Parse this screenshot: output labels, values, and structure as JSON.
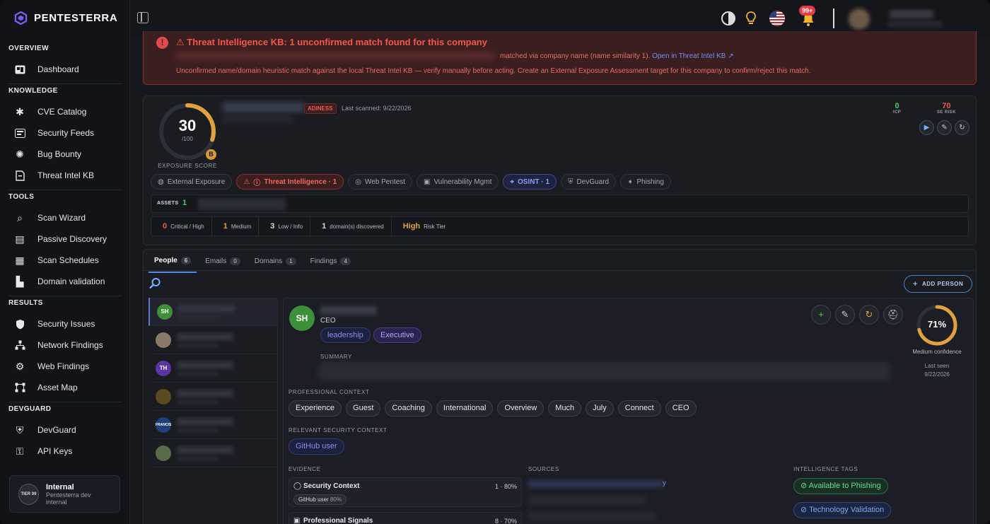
{
  "brand": {
    "name": "PENTESTERRA"
  },
  "sidebar": {
    "sections": [
      {
        "title": "OVERVIEW",
        "items": [
          {
            "label": "Dashboard",
            "icon": "dashboard-icon"
          }
        ]
      },
      {
        "title": "KNOWLEDGE",
        "items": [
          {
            "label": "CVE Catalog",
            "icon": "bug-catalog-icon"
          },
          {
            "label": "Security Feeds",
            "icon": "feed-icon"
          },
          {
            "label": "Bug Bounty",
            "icon": "bug-icon"
          },
          {
            "label": "Threat Intel KB",
            "icon": "document-icon"
          }
        ]
      },
      {
        "title": "TOOLS",
        "items": [
          {
            "label": "Scan Wizard",
            "icon": "wizard-icon"
          },
          {
            "label": "Passive Discovery",
            "icon": "discovery-icon"
          },
          {
            "label": "Scan Schedules",
            "icon": "calendar-icon"
          },
          {
            "label": "Domain validation",
            "icon": "building-icon"
          }
        ]
      },
      {
        "title": "RESULTS",
        "items": [
          {
            "label": "Security Issues",
            "icon": "shield-icon"
          },
          {
            "label": "Network Findings",
            "icon": "network-icon"
          },
          {
            "label": "Web Findings",
            "icon": "globe-icon"
          },
          {
            "label": "Asset Map",
            "icon": "map-icon"
          }
        ]
      },
      {
        "title": "DEVGUARD",
        "items": [
          {
            "label": "DevGuard",
            "icon": "devguard-icon"
          },
          {
            "label": "API Keys",
            "icon": "key-icon"
          }
        ]
      }
    ],
    "org": {
      "badge": "TIER 99",
      "name": "Internal",
      "subtitle": "Pentesterra dev internal"
    }
  },
  "topbar": {
    "notifications": "99+"
  },
  "alert": {
    "title": "⚠ Threat Intelligence KB: 1 unconfirmed match found for this company",
    "line1": "matched via company name (name similarity 1).",
    "link": "Open in Threat Intel KB ↗",
    "line2": "Unconfirmed name/domain heuristic match against the local Threat Intel KB — verify manually before acting. Create an External Exposure Assessment target for this company to confirm/reject this match."
  },
  "company": {
    "score": "30",
    "score_max": "/100",
    "grade": "B",
    "exposure_label": "EXPOSURE SCORE",
    "score_fraction": 0.3,
    "tag": "ADINESS",
    "last_scanned": "Last scanned: 9/22/2026",
    "kpis": [
      {
        "value": "0",
        "label": "ICP",
        "color": "#4ccf6a"
      },
      {
        "value": "70",
        "label": "SE RISK",
        "color": "#f05a4e"
      }
    ],
    "chips": [
      {
        "label": "External Exposure",
        "style": ""
      },
      {
        "label": "Threat Intelligence · 1",
        "style": "red"
      },
      {
        "label": "Web Pentest",
        "style": ""
      },
      {
        "label": "Vulnerability Mgmt",
        "style": ""
      },
      {
        "label": "OSINT · 1",
        "style": "blue"
      },
      {
        "label": "DevGuard",
        "style": ""
      },
      {
        "label": "Phishing",
        "style": ""
      }
    ],
    "assets_label": "ASSETS",
    "assets_count": "1",
    "stats": [
      {
        "n": "0",
        "l": "Critical / High",
        "color": "#f05a4e"
      },
      {
        "n": "1",
        "l": "Medium",
        "color": "#e0a23c"
      },
      {
        "n": "3",
        "l": "Low / Info",
        "color": "#d8dae3"
      },
      {
        "n": "1",
        "l": "domain(s) discovered",
        "color": "#d8dae3"
      },
      {
        "n": "High",
        "l": "Risk Tier",
        "color": "#e0a23c"
      }
    ]
  },
  "tabs": [
    {
      "label": "People",
      "count": "6"
    },
    {
      "label": "Emails",
      "count": "0"
    },
    {
      "label": "Domains",
      "count": "1"
    },
    {
      "label": "Findings",
      "count": "4"
    }
  ],
  "add_person": "ADD PERSON",
  "people": [
    {
      "initials": "SH",
      "color": "#3e8f3a"
    },
    {
      "initials": "",
      "color": "#8a7a6a"
    },
    {
      "initials": "TH",
      "color": "#5b35a0"
    },
    {
      "initials": "",
      "color": "#5a4a20"
    },
    {
      "initials": "FRANCIS",
      "color": "#1d3f7a"
    },
    {
      "initials": "",
      "color": "#5a6a4a"
    }
  ],
  "person": {
    "initials": "SH",
    "role": "CEO",
    "tags": [
      "leadership",
      "Executive"
    ],
    "summary_label": "SUMMARY",
    "confidence": "71%",
    "confidence_fraction": 0.71,
    "confidence_label": "Medium confidence",
    "last_seen_label": "Last seen",
    "last_seen": "9/22/2026",
    "prof_label": "PROFESSIONAL CONTEXT",
    "prof": [
      "Experience",
      "Guest",
      "Coaching",
      "International",
      "Overview",
      "Much",
      "July",
      "Connect",
      "CEO"
    ],
    "sec_label": "RELEVANT SECURITY CONTEXT",
    "sec": "GitHub user",
    "evidence_label": "EVIDENCE",
    "sources_label": "SOURCES",
    "intel_label": "INTELLIGENCE TAGS",
    "evidence": [
      {
        "title": "Security Context",
        "score": "1 · 80%",
        "chip": "GitHub user",
        "chip_pct": "80%"
      },
      {
        "title": "Professional Signals",
        "score": "8 · 70%"
      }
    ],
    "source_suffix": "y",
    "intel_tags": [
      {
        "label": "⊘ Available to Phishing",
        "color": "green"
      },
      {
        "label": "⊘ Technology Validation",
        "color": "blue"
      }
    ]
  }
}
